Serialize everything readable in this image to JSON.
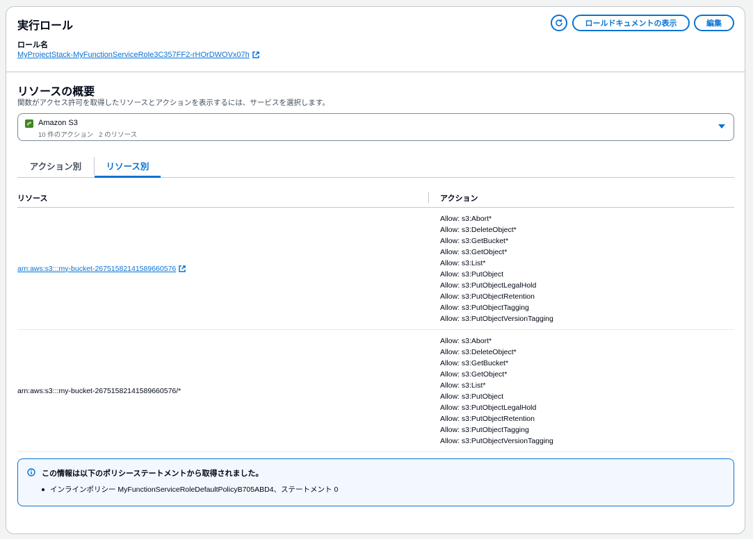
{
  "execution_role": {
    "title": "実行ロール",
    "role_name_label": "ロール名",
    "role_name_link": "MyProjectStack-MyFunctionServiceRole3C357FF2-rHOrDWOVx07h",
    "view_role_document_button": "ロールドキュメントの表示",
    "edit_button": "編集"
  },
  "resource_summary": {
    "title": "リソースの概要",
    "description": "関数がアクセス許可を取得したリソースとアクションを表示するには、サービスを選択します。",
    "service_select": {
      "selected": "Amazon S3",
      "subtitle": "10 件のアクション   2 のリソース"
    },
    "tabs": [
      {
        "label": "アクション別"
      },
      {
        "label": "リソース別"
      }
    ],
    "active_tab": "リソース別",
    "table": {
      "columns": [
        "リソース",
        "アクション"
      ],
      "rows": [
        {
          "resource": "arn:aws:s3:::my-bucket-26751582141589660576",
          "resource_is_link": true,
          "actions": [
            "Allow: s3:Abort*",
            "Allow: s3:DeleteObject*",
            "Allow: s3:GetBucket*",
            "Allow: s3:GetObject*",
            "Allow: s3:List*",
            "Allow: s3:PutObject",
            "Allow: s3:PutObjectLegalHold",
            "Allow: s3:PutObjectRetention",
            "Allow: s3:PutObjectTagging",
            "Allow: s3:PutObjectVersionTagging"
          ]
        },
        {
          "resource": "arn:aws:s3:::my-bucket-26751582141589660576/*",
          "resource_is_link": false,
          "actions": [
            "Allow: s3:Abort*",
            "Allow: s3:DeleteObject*",
            "Allow: s3:GetBucket*",
            "Allow: s3:GetObject*",
            "Allow: s3:List*",
            "Allow: s3:PutObject",
            "Allow: s3:PutObjectLegalHold",
            "Allow: s3:PutObjectRetention",
            "Allow: s3:PutObjectTagging",
            "Allow: s3:PutObjectVersionTagging"
          ]
        }
      ]
    },
    "info_box": {
      "title": "この情報は以下のポリシーステートメントから取得されました。",
      "items": [
        "インラインポリシー MyFunctionServiceRoleDefaultPolicyB705ABD4、ステートメント 0"
      ]
    }
  },
  "colors": {
    "link": "#0972d3",
    "border": "#c6c6cd",
    "info_bg": "#f2f8fd",
    "s3_icon": "#3f8624"
  }
}
